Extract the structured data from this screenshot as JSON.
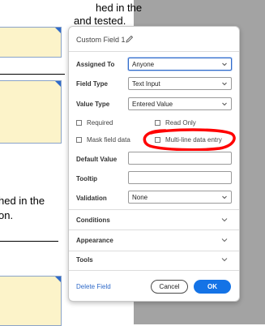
{
  "document": {
    "lines": [
      "hed in the",
      "and tested.",
      "hed in the",
      "on."
    ]
  },
  "panel": {
    "title": "Custom Field 1",
    "assigned_to": {
      "label": "Assigned To",
      "value": "Anyone"
    },
    "field_type": {
      "label": "Field Type",
      "value": "Text Input"
    },
    "value_type": {
      "label": "Value Type",
      "value": "Entered Value"
    },
    "checkboxes": {
      "required": "Required",
      "read_only": "Read Only",
      "mask_field_data": "Mask field data",
      "multi_line": "Multi-line data entry"
    },
    "default_value": {
      "label": "Default Value",
      "value": ""
    },
    "tooltip": {
      "label": "Tooltip",
      "value": ""
    },
    "validation": {
      "label": "Validation",
      "value": "None"
    },
    "sections": [
      "Conditions",
      "Appearance",
      "Tools"
    ],
    "delete_label": "Delete Field",
    "cancel_label": "Cancel",
    "ok_label": "OK"
  },
  "colors": {
    "accent": "#1473e6",
    "link": "#2f6ac9",
    "annotation": "#ff0000",
    "field_fill": "#fcf3c9",
    "background": "#a3a3a3"
  }
}
